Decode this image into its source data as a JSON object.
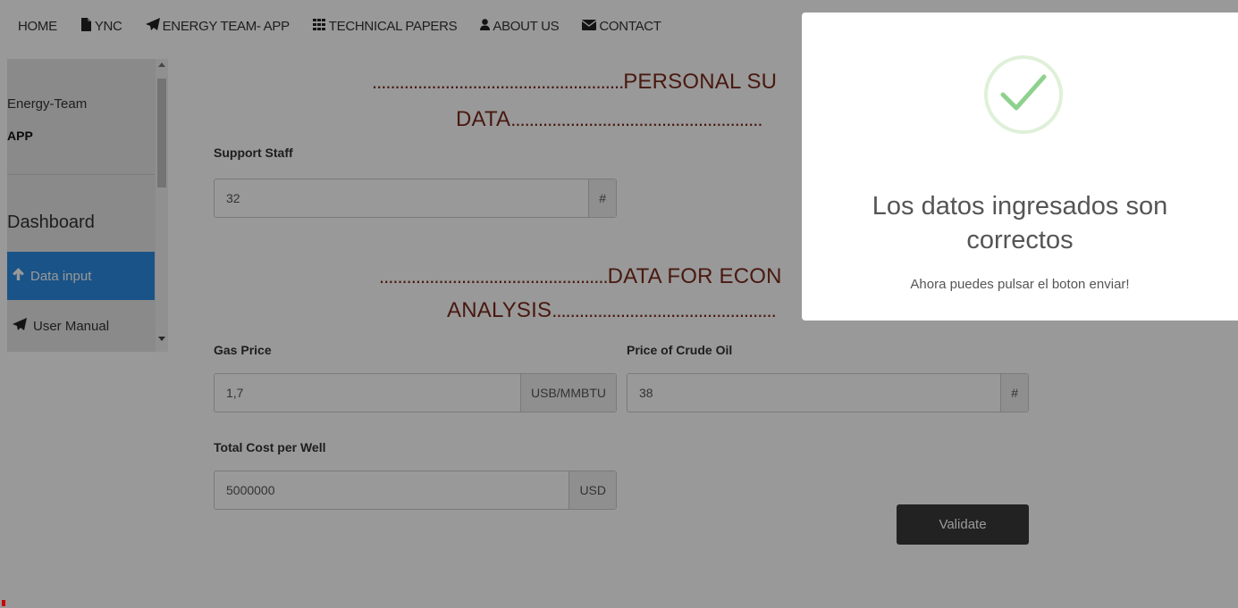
{
  "nav": {
    "items": [
      {
        "label": "HOME",
        "icon": "none"
      },
      {
        "label": "YNC",
        "icon": "file-icon"
      },
      {
        "label": "ENERGY TEAM- APP",
        "icon": "paper-plane-icon"
      },
      {
        "label": "TECHNICAL PAPERS",
        "icon": "grid-icon"
      },
      {
        "label": "ABOUT US",
        "icon": "user-icon"
      },
      {
        "label": "CONTACT",
        "icon": "envelope-icon"
      }
    ]
  },
  "sidebar": {
    "brand_line1": "Energy-Team",
    "brand_line2": "APP",
    "dashboard": "Dashboard",
    "items": [
      {
        "label": "Data input",
        "icon": "arrow-up-icon",
        "active": true
      },
      {
        "label": "User Manual",
        "icon": "paper-plane-icon",
        "active": false
      }
    ]
  },
  "form": {
    "section1": {
      "line1": "PERSONAL SU",
      "line2": "DATA"
    },
    "support_staff": {
      "label": "Support Staff",
      "value": "32",
      "addon": "#"
    },
    "section2": {
      "line1": "DATA FOR ECON",
      "line2": "ANALYSIS"
    },
    "gas_price": {
      "label": "Gas Price",
      "value": "1,7",
      "addon": "USB/MMBTU"
    },
    "crude_oil": {
      "label": "Price of Crude Oil",
      "value": "38",
      "addon": "#"
    },
    "total_cost": {
      "label": "Total Cost per Well",
      "value": "5000000",
      "addon": "USD"
    },
    "validate_label": "Validate"
  },
  "modal": {
    "title_line1": "Los datos ingresados son",
    "title_line2": "correctos",
    "text": "Ahora puedes pulsar el boton enviar!"
  },
  "colors": {
    "accent": "#2a8ae2",
    "heading": "#7a2a1c",
    "success": "#8ed18e"
  }
}
